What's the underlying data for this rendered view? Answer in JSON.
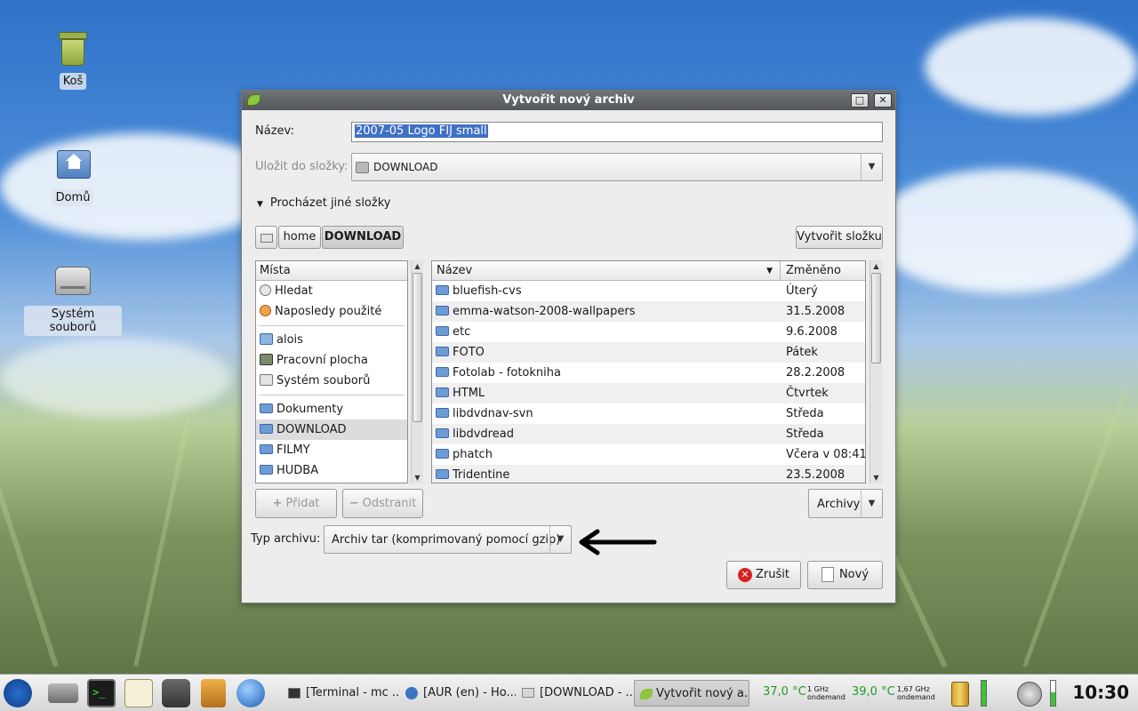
{
  "desktop": {
    "icons": [
      {
        "label": "Koš"
      },
      {
        "label": "Domů"
      },
      {
        "label": "Systém souborů"
      }
    ]
  },
  "dialog": {
    "title": "Vytvořit nový archiv",
    "name_label": "Název:",
    "name_value": "2007-05 Logo FIJ small",
    "save_to_label": "Uložit do složky:",
    "save_to_value": "DOWNLOAD",
    "browse_label": "Procházet jiné složky",
    "path_buttons": [
      "home",
      "DOWNLOAD"
    ],
    "create_folder_label": "Vytvořit složku",
    "places": {
      "header": "Místa",
      "items": [
        {
          "label": "Hledat",
          "icon": "search-icon"
        },
        {
          "label": "Naposledy použité",
          "icon": "recent-icon"
        },
        {
          "label": "alois",
          "icon": "home-folder-icon"
        },
        {
          "label": "Pracovní plocha",
          "icon": "desktop-icon"
        },
        {
          "label": "Systém souborů",
          "icon": "drive-icon"
        },
        {
          "label": "Dokumenty",
          "icon": "folder-icon"
        },
        {
          "label": "DOWNLOAD",
          "icon": "folder-icon",
          "selected": true
        },
        {
          "label": "FILMY",
          "icon": "folder-icon"
        },
        {
          "label": "HUDBA",
          "icon": "folder-icon"
        }
      ]
    },
    "files": {
      "col_name": "Název",
      "col_modified": "Změněno",
      "rows": [
        {
          "name": "bluefish-cvs",
          "modified": "Úterý"
        },
        {
          "name": "emma-watson-2008-wallpapers",
          "modified": "31.5.2008"
        },
        {
          "name": "etc",
          "modified": "9.6.2008"
        },
        {
          "name": "FOTO",
          "modified": "Pátek"
        },
        {
          "name": "Fotolab - fotokniha",
          "modified": "28.2.2008"
        },
        {
          "name": "HTML",
          "modified": "Čtvrtek"
        },
        {
          "name": "libdvdnav-svn",
          "modified": "Středa"
        },
        {
          "name": "libdvdread",
          "modified": "Středa"
        },
        {
          "name": "phatch",
          "modified": "Včera v 08:41"
        },
        {
          "name": "Tridentine",
          "modified": "23.5.2008"
        }
      ]
    },
    "add_label": "Přidat",
    "remove_label": "Odstranit",
    "filter_label": "Archivy",
    "archive_type_label": "Typ archivu:",
    "archive_type_value": "Archiv tar (komprimovaný pomocí gzip)",
    "cancel_label": "Zrušit",
    "new_label": "Nový"
  },
  "taskbar": {
    "tasks": [
      {
        "label": "[Terminal - mc ..."
      },
      {
        "label": "[AUR (en) - Ho..."
      },
      {
        "label": "[DOWNLOAD - ..."
      },
      {
        "label": "Vytvořit nový a...",
        "active": true
      }
    ],
    "cpu1_temp": "37,0 °C",
    "cpu1_freq": "1 GHz",
    "cpu1_gov": "ondemand",
    "cpu2_temp": "39,0 °C",
    "cpu2_freq": "1,67 GHz",
    "cpu2_gov": "ondemand",
    "clock": "10:30"
  },
  "colors": {
    "selection": "#3f70c5",
    "cpu_text": "#1e9b2d"
  }
}
